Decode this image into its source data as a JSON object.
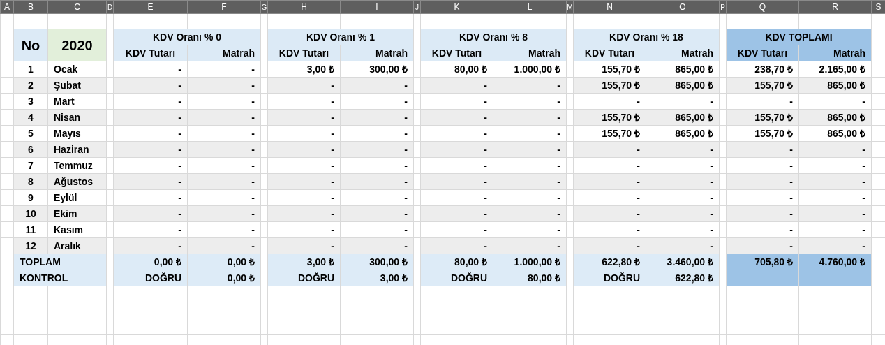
{
  "column_headers": [
    "A",
    "B",
    "C",
    "D",
    "E",
    "F",
    "G",
    "H",
    "I",
    "J",
    "K",
    "L",
    "M",
    "N",
    "O",
    "P",
    "Q",
    "R",
    "S"
  ],
  "header": {
    "no_label": "No",
    "year": "2020",
    "groups": [
      {
        "title": "KDV Oranı % 0",
        "kind": "rate",
        "sub": [
          "KDV Tutarı",
          "Matrah"
        ]
      },
      {
        "title": "KDV Oranı % 1",
        "kind": "rate",
        "sub": [
          "KDV Tutarı",
          "Matrah"
        ]
      },
      {
        "title": "KDV Oranı % 8",
        "kind": "rate",
        "sub": [
          "KDV Tutarı",
          "Matrah"
        ]
      },
      {
        "title": "KDV Oranı % 18",
        "kind": "rate",
        "sub": [
          "KDV Tutarı",
          "Matrah"
        ]
      },
      {
        "title": "KDV TOPLAMI",
        "kind": "total",
        "sub": [
          "KDV Tutarı",
          "Matrah"
        ]
      }
    ]
  },
  "rows": [
    {
      "no": "1",
      "month": "Ocak",
      "values": [
        "-",
        "-",
        "3,00 ₺",
        "300,00 ₺",
        "80,00 ₺",
        "1.000,00 ₺",
        "155,70 ₺",
        "865,00 ₺",
        "238,70 ₺",
        "2.165,00 ₺"
      ]
    },
    {
      "no": "2",
      "month": "Şubat",
      "values": [
        "-",
        "-",
        "-",
        "-",
        "-",
        "-",
        "155,70 ₺",
        "865,00 ₺",
        "155,70 ₺",
        "865,00 ₺"
      ]
    },
    {
      "no": "3",
      "month": "Mart",
      "values": [
        "-",
        "-",
        "-",
        "-",
        "-",
        "-",
        "-",
        "-",
        "-",
        "-"
      ]
    },
    {
      "no": "4",
      "month": "Nisan",
      "values": [
        "-",
        "-",
        "-",
        "-",
        "-",
        "-",
        "155,70 ₺",
        "865,00 ₺",
        "155,70 ₺",
        "865,00 ₺"
      ]
    },
    {
      "no": "5",
      "month": "Mayıs",
      "values": [
        "-",
        "-",
        "-",
        "-",
        "-",
        "-",
        "155,70 ₺",
        "865,00 ₺",
        "155,70 ₺",
        "865,00 ₺"
      ]
    },
    {
      "no": "6",
      "month": "Haziran",
      "values": [
        "-",
        "-",
        "-",
        "-",
        "-",
        "-",
        "-",
        "-",
        "-",
        "-"
      ]
    },
    {
      "no": "7",
      "month": "Temmuz",
      "values": [
        "-",
        "-",
        "-",
        "-",
        "-",
        "-",
        "-",
        "-",
        "-",
        "-"
      ]
    },
    {
      "no": "8",
      "month": "Ağustos",
      "values": [
        "-",
        "-",
        "-",
        "-",
        "-",
        "-",
        "-",
        "-",
        "-",
        "-"
      ]
    },
    {
      "no": "9",
      "month": "Eylül",
      "values": [
        "-",
        "-",
        "-",
        "-",
        "-",
        "-",
        "-",
        "-",
        "-",
        "-"
      ]
    },
    {
      "no": "10",
      "month": "Ekim",
      "values": [
        "-",
        "-",
        "-",
        "-",
        "-",
        "-",
        "-",
        "-",
        "-",
        "-"
      ]
    },
    {
      "no": "11",
      "month": "Kasım",
      "values": [
        "-",
        "-",
        "-",
        "-",
        "-",
        "-",
        "-",
        "-",
        "-",
        "-"
      ]
    },
    {
      "no": "12",
      "month": "Aralık",
      "values": [
        "-",
        "-",
        "-",
        "-",
        "-",
        "-",
        "-",
        "-",
        "-",
        "-"
      ]
    }
  ],
  "summary_rows": [
    {
      "label": "TOPLAM",
      "values": [
        "0,00 ₺",
        "0,00 ₺",
        "3,00 ₺",
        "300,00 ₺",
        "80,00 ₺",
        "1.000,00 ₺",
        "622,80 ₺",
        "3.460,00 ₺",
        "705,80 ₺",
        "4.760,00 ₺"
      ]
    },
    {
      "label": "KONTROL",
      "values": [
        "DOĞRU",
        "0,00 ₺",
        "DOĞRU",
        "3,00 ₺",
        "DOĞRU",
        "80,00 ₺",
        "DOĞRU",
        "622,80 ₺"
      ]
    }
  ]
}
